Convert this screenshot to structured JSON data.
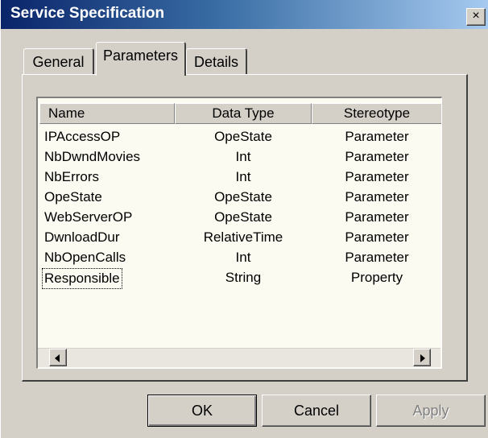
{
  "window": {
    "title": "Service Specification",
    "close_glyph": "×",
    "icons": {
      "close": "close-icon",
      "scroll_left": "arrow-left-icon",
      "scroll_right": "arrow-right-icon"
    }
  },
  "tabs": [
    {
      "label": "General",
      "active": false
    },
    {
      "label": "Parameters",
      "active": true
    },
    {
      "label": "Details",
      "active": false
    }
  ],
  "table": {
    "columns": [
      "Name",
      "Data Type",
      "Stereotype"
    ],
    "rows": [
      {
        "name": "IPAccessOP",
        "type": "OpeState",
        "stereotype": "Parameter"
      },
      {
        "name": "NbDwndMovies",
        "type": "Int",
        "stereotype": "Parameter"
      },
      {
        "name": "NbErrors",
        "type": "Int",
        "stereotype": "Parameter"
      },
      {
        "name": "OpeState",
        "type": "OpeState",
        "stereotype": "Parameter"
      },
      {
        "name": "WebServerOP",
        "type": "OpeState",
        "stereotype": "Parameter"
      },
      {
        "name": "DwnloadDur",
        "type": "RelativeTime",
        "stereotype": "Parameter"
      },
      {
        "name": "NbOpenCalls",
        "type": "Int",
        "stereotype": "Parameter"
      },
      {
        "name": "Responsible",
        "type": "String",
        "stereotype": "Property",
        "focused": true
      }
    ]
  },
  "buttons": {
    "ok": "OK",
    "cancel": "Cancel",
    "apply": "Apply",
    "apply_enabled": false
  },
  "colors": {
    "title_gradient_start": "#0a246a",
    "title_gradient_end": "#a6caf0",
    "dialog_face": "#d4d0c8",
    "list_background": "#fcfbf1"
  }
}
